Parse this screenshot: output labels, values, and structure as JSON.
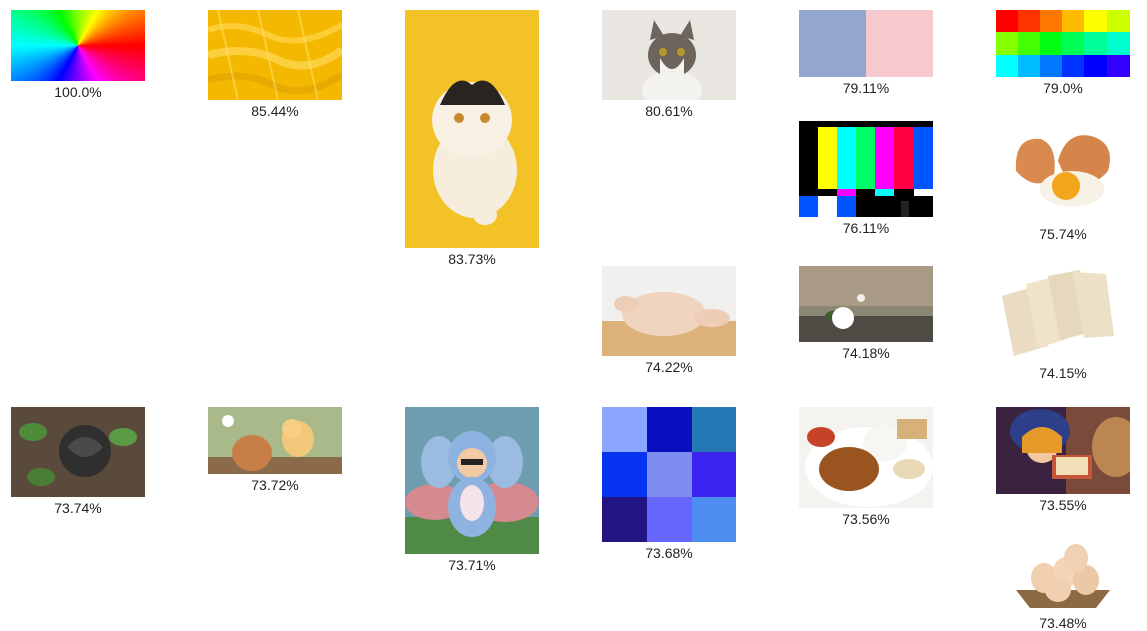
{
  "results": [
    {
      "thumbnail": "rainbow-gradient",
      "score": "100.0%"
    },
    {
      "thumbnail": "yellow-fur-texture",
      "score": "85.44%"
    },
    {
      "thumbnail": "white-cat-yellow-background",
      "score": "83.73%"
    },
    {
      "thumbnail": "tabby-cat-portrait",
      "score": "80.61%"
    },
    {
      "thumbnail": "blue-pink-swatches",
      "score": "79.11%"
    },
    {
      "thumbnail": "color-grid",
      "score": "79.0%"
    },
    {
      "thumbnail": "tv-color-bars",
      "score": "76.11%"
    },
    {
      "thumbnail": "cracked-egg-yolk",
      "score": "75.74%"
    },
    {
      "thumbnail": "raw-chicken",
      "score": "74.22%"
    },
    {
      "thumbnail": "white-rose-on-wood",
      "score": "74.18%"
    },
    {
      "thumbnail": "paper-envelopes",
      "score": "74.15%"
    },
    {
      "thumbnail": "black-rose",
      "score": "73.74%"
    },
    {
      "thumbnail": "egg-and-chick",
      "score": "73.72%"
    },
    {
      "thumbnail": "cartoon-character-elephant-costume",
      "score": "73.71%"
    },
    {
      "thumbnail": "blue-color-grid",
      "score": "73.68%"
    },
    {
      "thumbnail": "fried-chicken-rice-plate",
      "score": "73.56%"
    },
    {
      "thumbnail": "fantasy-girl-reading-book",
      "score": "73.55%"
    },
    {
      "thumbnail": "eggs-in-basket",
      "score": "73.48%"
    }
  ]
}
